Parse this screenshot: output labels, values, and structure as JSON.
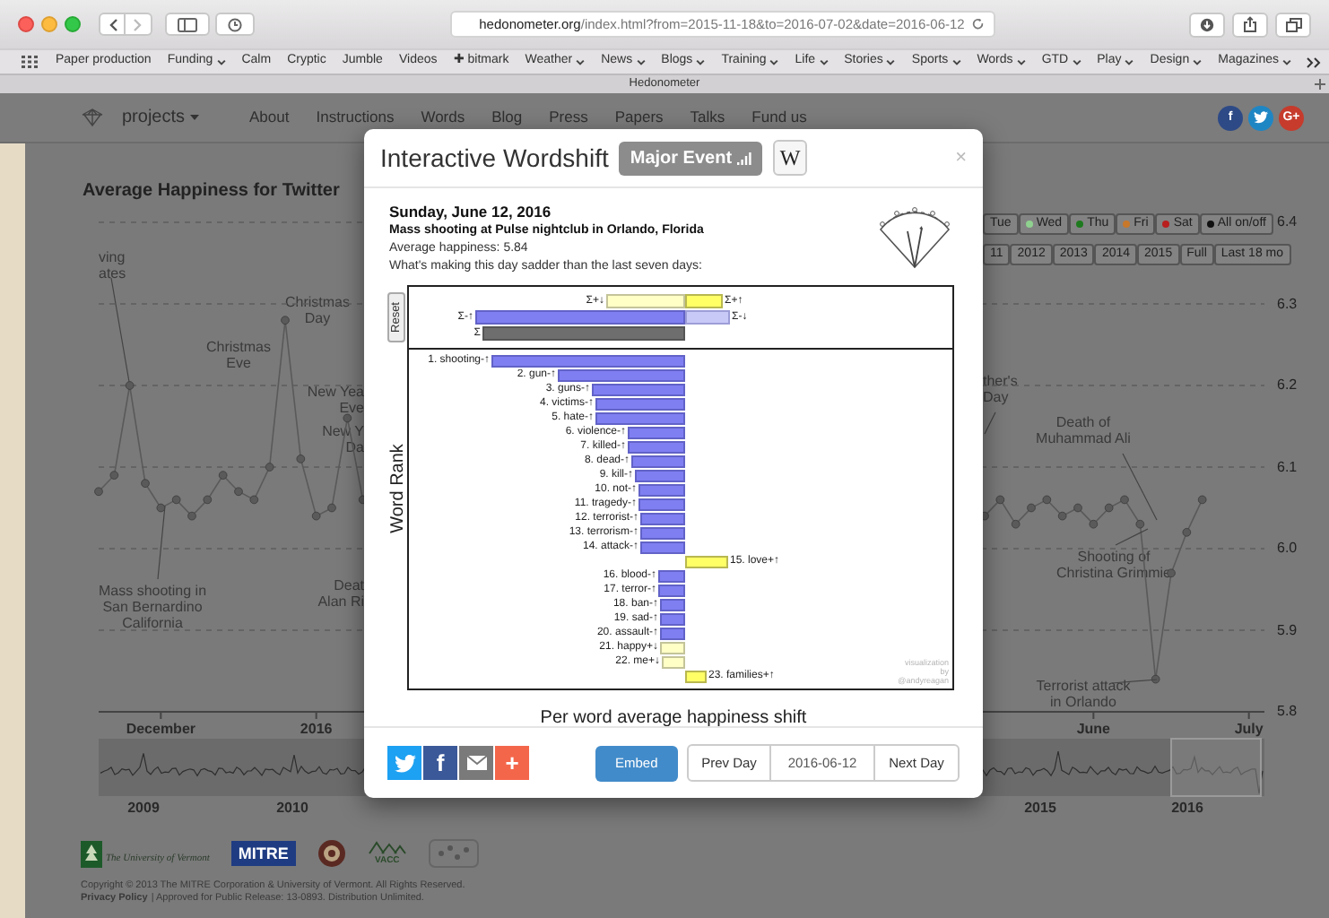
{
  "browser": {
    "url": {
      "host": "hedonometer.org",
      "path": "/index.html?from=2015-11-18&to=2016-07-02&date=2016-06-12"
    },
    "bookmarks": [
      {
        "label": "Paper production",
        "folder": false
      },
      {
        "label": "Funding",
        "folder": true
      },
      {
        "label": "Calm",
        "folder": false
      },
      {
        "label": "Cryptic",
        "folder": false
      },
      {
        "label": "Jumble",
        "folder": false
      },
      {
        "label": "Videos",
        "folder": false
      },
      {
        "label": "✚ bitmark",
        "folder": false
      },
      {
        "label": "Weather",
        "folder": true
      },
      {
        "label": "News",
        "folder": true
      },
      {
        "label": "Blogs",
        "folder": true
      },
      {
        "label": "Training",
        "folder": true
      },
      {
        "label": "Life",
        "folder": true
      },
      {
        "label": "Stories",
        "folder": true
      },
      {
        "label": "Sports",
        "folder": true
      },
      {
        "label": "Words",
        "folder": true
      },
      {
        "label": "GTD",
        "folder": true
      },
      {
        "label": "Play",
        "folder": true
      },
      {
        "label": "Design",
        "folder": true
      },
      {
        "label": "Magazines",
        "folder": true
      }
    ],
    "tab_title": "Hedonometer"
  },
  "page": {
    "nav": {
      "brand": "projects",
      "links": [
        "About",
        "Instructions",
        "Words",
        "Blog",
        "Press",
        "Papers",
        "Talks",
        "Fund us"
      ],
      "social": [
        {
          "kind": "facebook",
          "glyph": "f"
        },
        {
          "kind": "twitter"
        },
        {
          "kind": "google",
          "glyph": "G+"
        }
      ]
    },
    "title": "Average Happiness for Twitter",
    "day_filters": [
      {
        "label": "Tue"
      },
      {
        "label": "Wed",
        "color": "#8fd18f"
      },
      {
        "label": "Thu",
        "color": "#1e7a1e"
      },
      {
        "label": "Fri",
        "color": "#c8782a"
      },
      {
        "label": "Sat",
        "color": "#b81e1e"
      },
      {
        "label": "All on/off",
        "color": "#111111"
      }
    ],
    "ranges": [
      "11",
      "2012",
      "2013",
      "2014",
      "2015",
      "Full",
      "Last 18 mo"
    ],
    "chart_data": {
      "type": "line",
      "grid": true,
      "ylim": [
        5.8,
        6.4
      ],
      "categories": [
        null,
        null,
        null,
        null,
        "December",
        null,
        null,
        null,
        null,
        null,
        null,
        null,
        null,
        null,
        "2016",
        null,
        null,
        null,
        null,
        null,
        null,
        null,
        null,
        null,
        null,
        null,
        null,
        null,
        null,
        null,
        null,
        null,
        null,
        null,
        null,
        null,
        null,
        null,
        null,
        null,
        null,
        null,
        null,
        null,
        null,
        null,
        null,
        null,
        null,
        null,
        null,
        null,
        null,
        null,
        null,
        null,
        null,
        null,
        null,
        null,
        null,
        null,
        null,
        null,
        "June",
        null,
        null,
        null,
        null,
        null,
        null,
        null,
        null,
        null,
        "July",
        null
      ],
      "yticks": [
        {
          "value": 6.4,
          "label": "6.4"
        },
        {
          "value": 6.3,
          "label": "6.3"
        },
        {
          "value": 6.2,
          "label": "6.2"
        },
        {
          "value": 6.1,
          "label": "6.1"
        },
        {
          "value": 6.0,
          "label": "6.0"
        },
        {
          "value": 5.9,
          "label": "5.9"
        },
        {
          "value": 5.8,
          "label": "5.8"
        }
      ],
      "series": [
        {
          "color": "#5a5a5a",
          "marker": true,
          "values": [
            6.07,
            6.09,
            6.2,
            6.08,
            6.05,
            6.06,
            6.04,
            6.06,
            6.09,
            6.07,
            6.06,
            6.1,
            6.28,
            6.11,
            6.04,
            6.05,
            6.16,
            6.06,
            null,
            null,
            null,
            null,
            null,
            null,
            null,
            null,
            null,
            null,
            null,
            null,
            null,
            null,
            null,
            null,
            null,
            null,
            null,
            null,
            null,
            null,
            null,
            null,
            null,
            null,
            null,
            null,
            null,
            null,
            null,
            null,
            null,
            null,
            null,
            null,
            null,
            null,
            null,
            6.04,
            6.06,
            6.03,
            6.05,
            6.06,
            6.04,
            6.05,
            6.03,
            6.05,
            6.06,
            6.03,
            5.84,
            5.97,
            6.02,
            6.06,
            null,
            null,
            null,
            null
          ]
        }
      ],
      "annotations": [
        {
          "text": "ving\nates"
        },
        {
          "text": "Christmas\nEve"
        },
        {
          "text": "Christmas\nDay"
        },
        {
          "text": "New Yea\nEve"
        },
        {
          "text": "New Y\nDa"
        },
        {
          "text": "Mass shooting in\nSan Bernardino\nCalifornia"
        },
        {
          "text": "Deat\nAlan Ri"
        },
        {
          "text": "ther's\nDay"
        },
        {
          "text": "Death of\nMuhammad Ali"
        },
        {
          "text": "Shooting of\nChristina Grimmie"
        },
        {
          "text": "Terrorist attack\nin Orlando"
        }
      ]
    },
    "overview_labels": [
      "2009",
      "2010",
      "2015",
      "2016"
    ],
    "footer": {
      "uvm": "The University of Vermont",
      "mitre": "MITRE",
      "vacc": "VACC",
      "copyright": "Copyright © 2013 The MITRE Corporation & University of Vermont. All Rights Reserved.",
      "privacy_link": "Privacy Policy",
      "release": "| Approved for Public Release: 13-0893. Distribution Unlimited."
    }
  },
  "modal": {
    "title": "Interactive Wordshift",
    "badge": "Major Event",
    "wiki": "W",
    "close": "×",
    "date": "Sunday, June 12, 2016",
    "event": "Mass shooting at Pulse nightclub in Orlando, Florida",
    "average": "Average happiness: 5.84",
    "question": "What's making this day sadder than the last seven days:",
    "reset": "Reset",
    "y_label": "Word Rank",
    "x_label": "Per word average happiness shift",
    "credit": "visualization by @andyreagan",
    "summary": [
      {
        "label": "Σ+↓",
        "kind": "plus-down"
      },
      {
        "label": "Σ+↑",
        "kind": "plus-up"
      },
      {
        "label": "Σ-↑",
        "kind": "minus-up"
      },
      {
        "label": "Σ-↓",
        "kind": "minus-down"
      },
      {
        "label": "Σ",
        "kind": "total"
      }
    ],
    "words": [
      {
        "label": "1. shooting-↑",
        "kind": "minus-up"
      },
      {
        "label": "2. gun-↑",
        "kind": "minus-up"
      },
      {
        "label": "3. guns-↑",
        "kind": "minus-up"
      },
      {
        "label": "4. victims-↑",
        "kind": "minus-up"
      },
      {
        "label": "5. hate-↑",
        "kind": "minus-up"
      },
      {
        "label": "6. violence-↑",
        "kind": "minus-up"
      },
      {
        "label": "7. killed-↑",
        "kind": "minus-up"
      },
      {
        "label": "8. dead-↑",
        "kind": "minus-up"
      },
      {
        "label": "9. kill-↑",
        "kind": "minus-up"
      },
      {
        "label": "10. not-↑",
        "kind": "minus-up"
      },
      {
        "label": "11. tragedy-↑",
        "kind": "minus-up"
      },
      {
        "label": "12. terrorist-↑",
        "kind": "minus-up"
      },
      {
        "label": "13. terrorism-↑",
        "kind": "minus-up"
      },
      {
        "label": "14. attack-↑",
        "kind": "minus-up"
      },
      {
        "label": "15. love+↑",
        "kind": "plus-up"
      },
      {
        "label": "16. blood-↑",
        "kind": "minus-up"
      },
      {
        "label": "17. terror-↑",
        "kind": "minus-up"
      },
      {
        "label": "18. ban-↑",
        "kind": "minus-up"
      },
      {
        "label": "19. sad-↑",
        "kind": "minus-up"
      },
      {
        "label": "20. assault-↑",
        "kind": "minus-up"
      },
      {
        "label": "21. happy+↓",
        "kind": "plus-down"
      },
      {
        "label": "22. me+↓",
        "kind": "plus-down"
      },
      {
        "label": "23. families+↑",
        "kind": "plus-up"
      }
    ],
    "share": [
      {
        "kind": "twitter"
      },
      {
        "kind": "facebook",
        "glyph": "f"
      },
      {
        "kind": "email"
      },
      {
        "kind": "more",
        "glyph": "+"
      }
    ],
    "embed": "Embed",
    "prev": "Prev Day",
    "date_field": "2016-06-12",
    "next": "Next Day"
  }
}
